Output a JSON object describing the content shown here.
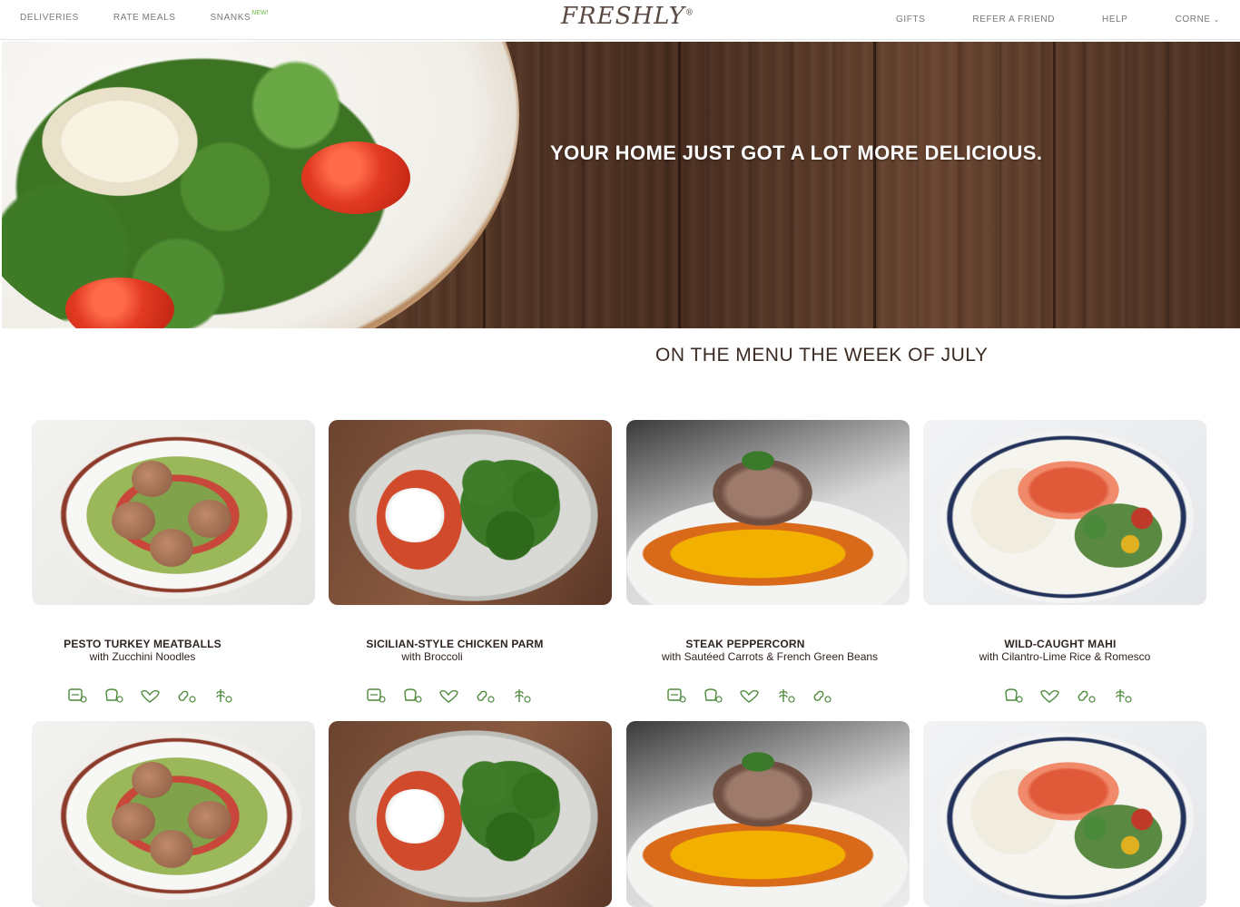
{
  "nav": {
    "left": [
      "DELIVERIES",
      "RATE MEALS",
      "SNANKS"
    ],
    "new_badge": "NEW!",
    "right": [
      "GIFTS",
      "REFER A FRIEND",
      "HELP",
      "CORNE"
    ],
    "logo": "FRESHLY",
    "logo_mark": "®"
  },
  "hero": {
    "headline": "YOUR HOME JUST GOT A LOT MORE DELICIOUS."
  },
  "menu": {
    "heading": "ON THE MENU THE WEEK OF JULY",
    "meals": [
      {
        "title": "PESTO TURKEY MEATBALLS",
        "subtitle": "with Zucchini Noodles",
        "icons": [
          "gluten-free-icon",
          "bread-free-icon",
          "heart-icon",
          "peanut-free-icon",
          "wheat-free-icon"
        ]
      },
      {
        "title": "SICILIAN-STYLE CHICKEN PARM",
        "subtitle": "with Broccoli",
        "icons": [
          "gluten-free-icon",
          "bread-free-icon",
          "heart-icon",
          "peanut-free-icon",
          "wheat-free-icon"
        ]
      },
      {
        "title": "STEAK PEPPERCORN",
        "subtitle": "with Sautéed Carrots & French Green Beans",
        "icons": [
          "gluten-free-icon",
          "bread-free-icon",
          "heart-icon",
          "wheat-free-icon",
          "peanut-free-icon"
        ]
      },
      {
        "title": "WILD-CAUGHT MAHI",
        "subtitle": "with Cilantro-Lime Rice & Romesco",
        "icons": [
          "bread-free-icon",
          "heart-icon",
          "peanut-free-icon",
          "wheat-free-icon"
        ]
      }
    ]
  },
  "colors": {
    "icon_green": "#4d8a3a",
    "text_brown": "#3b2b24",
    "new_green": "#6dbb4a"
  }
}
